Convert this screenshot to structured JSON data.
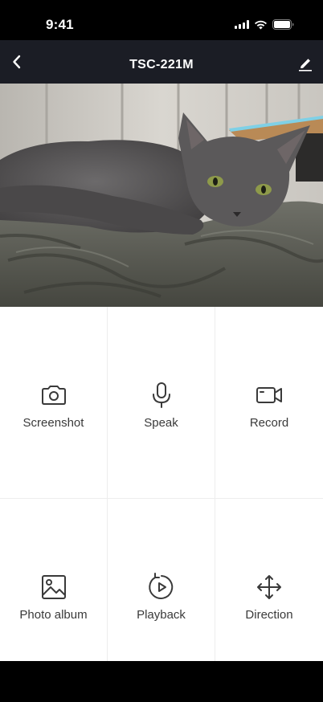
{
  "status_bar": {
    "time": "9:41"
  },
  "nav": {
    "title": "TSC-221M"
  },
  "actions": [
    {
      "label": "Screenshot",
      "icon": "camera-icon"
    },
    {
      "label": "Speak",
      "icon": "microphone-icon"
    },
    {
      "label": "Record",
      "icon": "video-camera-icon"
    },
    {
      "label": "Photo album",
      "icon": "image-icon"
    },
    {
      "label": "Playback",
      "icon": "playback-icon"
    },
    {
      "label": "Direction",
      "icon": "move-arrows-icon"
    }
  ],
  "colors": {
    "nav_background": "#1b1d25",
    "icon_color": "#3a3a3a",
    "panel_background": "#ffffff"
  }
}
